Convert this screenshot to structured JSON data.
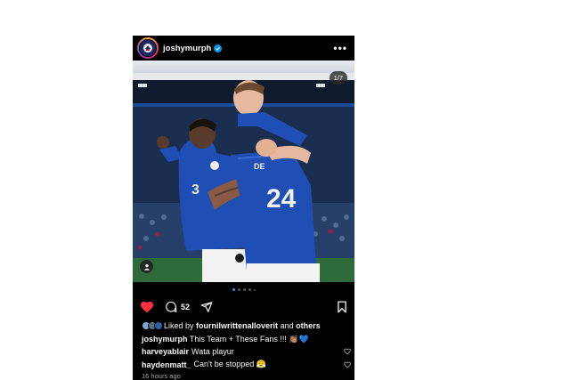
{
  "post": {
    "username": "joshymurph",
    "verified": true,
    "more_label": "•••",
    "photo_counter": "1/7",
    "carousel_index": 1,
    "carousel_total": 7,
    "like_state": "liked",
    "comment_count": "52",
    "liked_by_prefix": "Liked by",
    "liked_by_user": "fournilwrittenalloverit",
    "liked_by_and": "and",
    "liked_by_others": "others",
    "caption_user": "joshymurph",
    "caption_text": "This Team + These Fans !!! 👏🏽💙",
    "comments": [
      {
        "user": "harveyablair",
        "text": "Wata playur"
      },
      {
        "user": "haydenmatt_",
        "text": "Can't be stopped 😤"
      }
    ],
    "timestamp": "16 hours ago",
    "colors": {
      "accent_like": "#ff3040",
      "verified": "#0095f6",
      "kit_blue": "#1f4fb5"
    },
    "icons": [
      "more-icon",
      "heart-icon",
      "comment-icon",
      "share-icon",
      "bookmark-icon",
      "tag-user-icon"
    ]
  }
}
